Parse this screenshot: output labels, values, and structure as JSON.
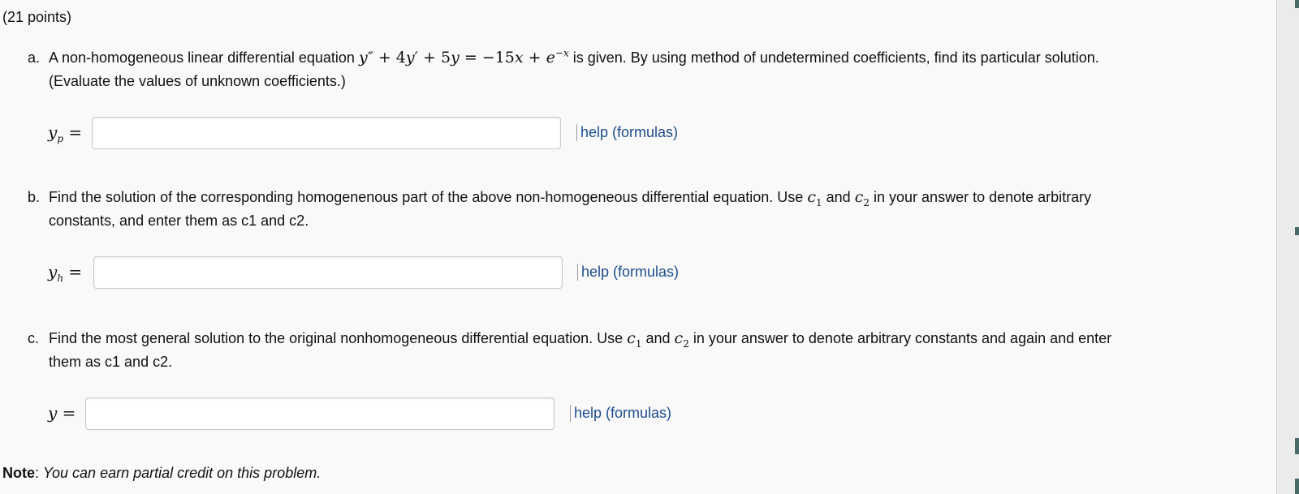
{
  "header": {
    "points": "(21 points)"
  },
  "parts": {
    "a": {
      "letter": "a.",
      "text_before": "A non-homogeneous linear differential equation",
      "text_after": "is given. By using method of undetermined coefficients, find its particular solution.",
      "text_line2": "(Evaluate the values of unknown coefficients.)",
      "answer_label": "y",
      "answer_sub": "p",
      "answer_value": "",
      "help_label": "help (formulas)"
    },
    "b": {
      "letter": "b.",
      "text_before": "Find the solution of the corresponding homogenenous part of the above non-homogeneous differential equation. Use",
      "text_mid": "and",
      "text_after": "in your answer to denote arbitrary",
      "text_line2": "constants, and enter them as c1 and c2.",
      "answer_label": "y",
      "answer_sub": "h",
      "answer_value": "",
      "help_label": "help (formulas)"
    },
    "c": {
      "letter": "c.",
      "text_before": "Find the most general solution to the original nonhomogeneous differential equation. Use",
      "text_mid": "and",
      "text_after": "in your answer to denote arbitrary constants and again and enter",
      "text_line2": "them as c1 and c2.",
      "answer_label": "y",
      "answer_value": "",
      "help_label": "help (formulas)"
    }
  },
  "note": {
    "label": "Note",
    "text": "You can earn partial credit on this problem."
  }
}
